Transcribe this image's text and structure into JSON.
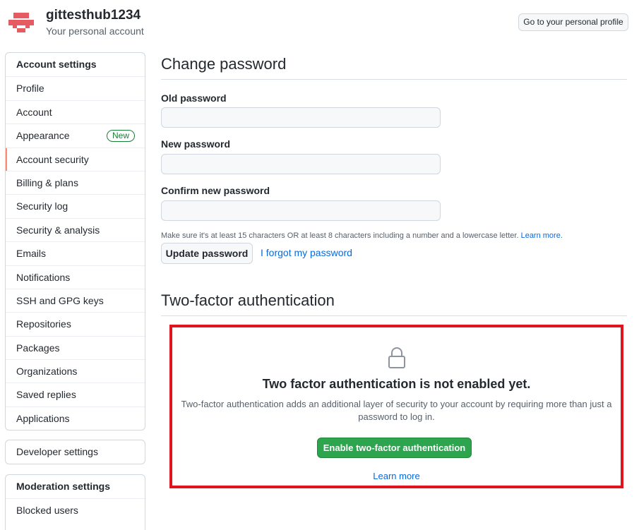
{
  "header": {
    "username": "gittesthub1234",
    "subtitle": "Your personal account",
    "profile_button": "Go to your personal profile"
  },
  "sidebar": {
    "account_settings": {
      "heading": "Account settings",
      "items": [
        {
          "label": "Profile"
        },
        {
          "label": "Account"
        },
        {
          "label": "Appearance",
          "badge": "New"
        },
        {
          "label": "Account security",
          "selected": true
        },
        {
          "label": "Billing & plans"
        },
        {
          "label": "Security log"
        },
        {
          "label": "Security & analysis"
        },
        {
          "label": "Emails"
        },
        {
          "label": "Notifications"
        },
        {
          "label": "SSH and GPG keys"
        },
        {
          "label": "Repositories"
        },
        {
          "label": "Packages"
        },
        {
          "label": "Organizations"
        },
        {
          "label": "Saved replies"
        },
        {
          "label": "Applications"
        }
      ]
    },
    "developer_settings": "Developer settings",
    "moderation_settings": {
      "heading": "Moderation settings",
      "items": [
        {
          "label": "Blocked users"
        }
      ]
    }
  },
  "password": {
    "title": "Change password",
    "old_label": "Old password",
    "new_label": "New password",
    "confirm_label": "Confirm new password",
    "old_value": "",
    "new_value": "",
    "confirm_value": "",
    "note": "Make sure it's at least 15 characters OR at least 8 characters including a number and a lowercase letter.",
    "note_link": "Learn more.",
    "update_button": "Update password",
    "forgot_link": "I forgot my password"
  },
  "two_factor": {
    "title": "Two-factor authentication",
    "heading": "Two factor authentication is not enabled yet.",
    "description": "Two-factor authentication adds an additional layer of security to your account by requiring more than just a password to log in.",
    "enable_button": "Enable two-factor authentication",
    "learn_more": "Learn more",
    "highlight_color": "#e0141f"
  },
  "colors": {
    "accent_green": "#2da44e",
    "link_blue": "#0969da",
    "selected_marker": "#fd8c73"
  }
}
